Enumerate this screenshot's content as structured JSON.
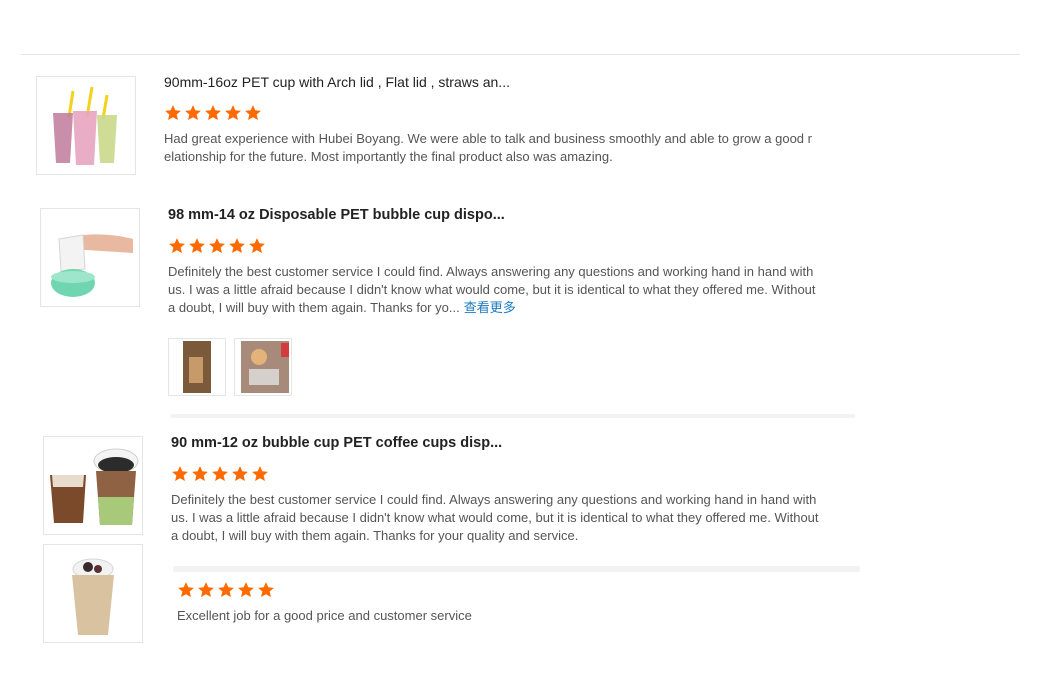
{
  "colors": {
    "star": "#ff6a00",
    "link": "#1a7bbf",
    "divider": "#e6e6e6"
  },
  "reviews": [
    {
      "title": "90mm-16oz PET cup with Arch lid , Flat lid , straws an...",
      "rating": 5,
      "text": "Had great experience with Hubei Boyang. We were able to talk and business smoothly and able to grow a good relationship for the future. Most importantly the final product also was amazing."
    },
    {
      "title": "98 mm-14 oz Disposable PET bubble cup dispo...",
      "rating": 5,
      "text": "Definitely the best customer service I could find. Always answering any questions and working hand in hand with us. I was a little afraid because I didn't know what would come, but it is identical to what they offered me. Without a doubt, I will buy with them again. Thanks for yo...",
      "more_label": "查看更多"
    },
    {
      "title": "90 mm-12 oz bubble cup PET coffee cups disp...",
      "rating": 5,
      "text": "Definitely the best customer service I could find. Always answering any questions and working hand in hand with us. I was a little afraid because I didn't know what would come, but it is identical to what they offered me. Without a doubt, I will buy with them again. Thanks for your quality and service."
    },
    {
      "rating": 5,
      "text": "Excellent job for a good price and customer service"
    }
  ]
}
